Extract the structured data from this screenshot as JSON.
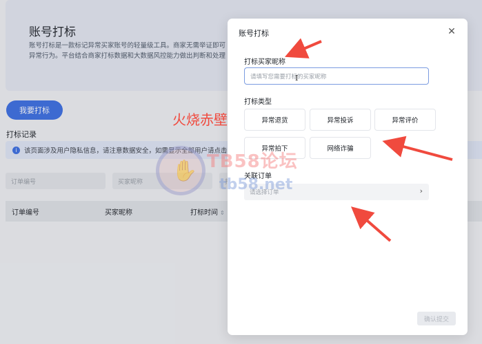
{
  "page": {
    "title": "账号打标",
    "description_lines": [
      "账号打标是一款标记异常买家账号的轻量级工具。商家无需举证即可",
      "异常行为。平台结合商家打标数据和大数据风控能力做出判断和处理"
    ],
    "primary_button": "我要打标",
    "records_title": "打标记录",
    "notice_text": "该页面涉及用户隐私信息，请注意数据安全，如需显示全部用户请点击",
    "filters": [
      "订单编号",
      "买家昵称",
      "打"
    ],
    "table_headers": [
      "订单编号",
      "买家昵称",
      "打标时间"
    ]
  },
  "modal": {
    "title": "账号打标",
    "nickname_label": "打标买家昵称",
    "nickname_placeholder": "请填写您需要打标的买家昵称",
    "type_label": "打标类型",
    "type_options": [
      "异常退货",
      "异常投诉",
      "异常评价",
      "异常拍下",
      "网络诈骗"
    ],
    "order_label": "关联订单",
    "order_placeholder": "请选择订单",
    "submit_label": "确认提交"
  },
  "watermarks": {
    "red_text": "火烧赤壁",
    "logo_text": "TB58论坛",
    "site_text": "tb58.net"
  },
  "icons": {
    "close": "close-icon",
    "info": "info-icon",
    "chevron": "chevron-right-icon",
    "sort": "sort-icon"
  },
  "colors": {
    "primary": "#3c6fe3",
    "annotation_arrow": "#f04a3e"
  }
}
